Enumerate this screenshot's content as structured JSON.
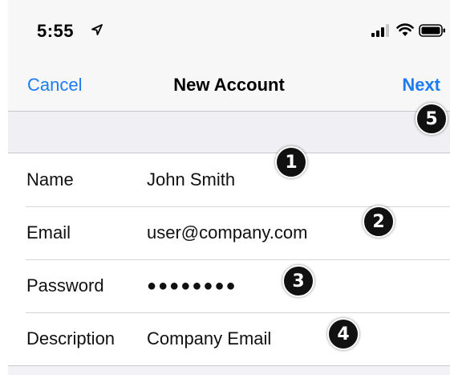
{
  "status_bar": {
    "time": "5:55",
    "icons": [
      "location-arrow-icon",
      "cellular-signal-icon",
      "wifi-icon",
      "battery-icon"
    ]
  },
  "navbar": {
    "cancel_label": "Cancel",
    "title": "New Account",
    "next_label": "Next"
  },
  "form": {
    "rows": [
      {
        "label": "Name",
        "value": "John Smith"
      },
      {
        "label": "Email",
        "value": "user@company.com"
      },
      {
        "label": "Password",
        "value": "●●●●●●●●"
      },
      {
        "label": "Description",
        "value": "Company Email"
      }
    ]
  },
  "annotations": [
    "1",
    "2",
    "3",
    "4",
    "5"
  ],
  "colors": {
    "accent": "#1d7cf2",
    "background": "#f2f2f7",
    "badge": "#111111"
  }
}
